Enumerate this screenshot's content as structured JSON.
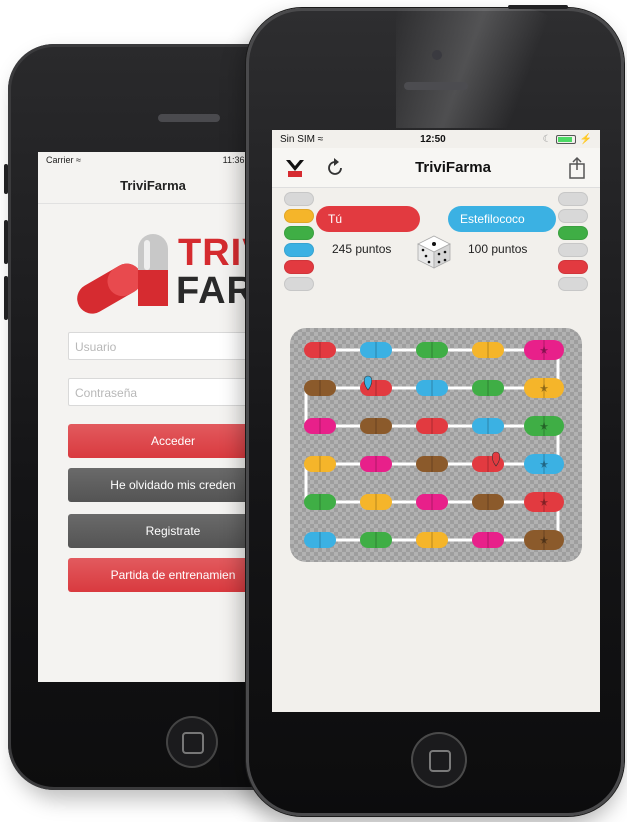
{
  "back_phone": {
    "status": {
      "carrier": "Carrier",
      "time": "11:36 AM"
    },
    "nav_title": "TriviFarma",
    "logo": {
      "line1": "TRIV",
      "line2": "FAR"
    },
    "login": {
      "username_placeholder": "Usuario",
      "password_placeholder": "Contraseña",
      "login_label": "Acceder",
      "forgot_label": "He olvidado mis creden",
      "register_label": "Registrate",
      "training_label": "Partida de entrenamien"
    }
  },
  "front_phone": {
    "status": {
      "carrier": "Sin SIM",
      "time": "12:50"
    },
    "nav_title": "TriviFarma",
    "player1": {
      "name": "Tú",
      "score": "245 puntos",
      "color": "#e23a40"
    },
    "player2": {
      "name": "Estefilococo",
      "score": "100 puntos",
      "color": "#3bb1e3"
    },
    "player1_chips": [
      "#d8d8d8",
      "#f5b52a",
      "#3fae45",
      "#3bb1e3",
      "#e23a40",
      "#d8d8d8"
    ],
    "player2_chips": [
      "#d8d8d8",
      "#d8d8d8",
      "#3fae45",
      "#d8d8d8",
      "#e23a40",
      "#d8d8d8"
    ],
    "board": {
      "rows": [
        [
          "#e23a40",
          "#3bb1e3",
          "#3fae45",
          "#f5b52a",
          "#e8208a"
        ],
        [
          "#8b5a2b",
          "#e23a40",
          "#3bb1e3",
          "#3fae45",
          "#f5b52a"
        ],
        [
          "#e8208a",
          "#8b5a2b",
          "#e23a40",
          "#3bb1e3",
          "#3fae45"
        ],
        [
          "#f5b52a",
          "#e8208a",
          "#8b5a2b",
          "#e23a40",
          "#3bb1e3"
        ],
        [
          "#3fae45",
          "#f5b52a",
          "#e8208a",
          "#8b5a2b",
          "#e23a40"
        ],
        [
          "#3bb1e3",
          "#3fae45",
          "#f5b52a",
          "#e8208a",
          "#8b5a2b"
        ]
      ],
      "star_column": 4
    }
  }
}
